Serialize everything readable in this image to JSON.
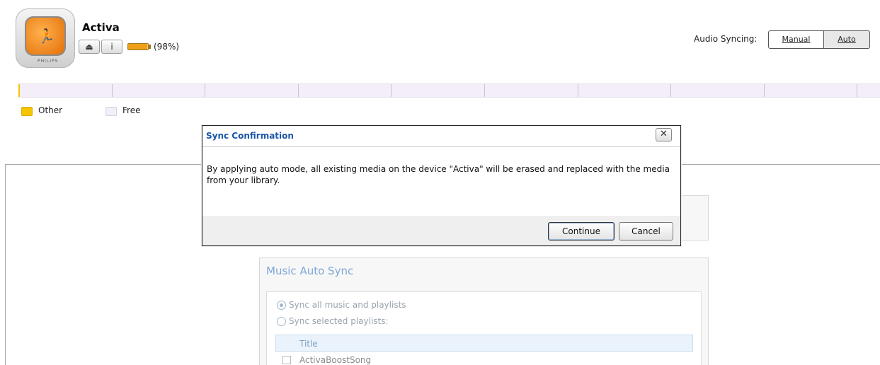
{
  "device": {
    "name": "Activa",
    "brand": "PHILIPS",
    "screen_text": "Move",
    "eject_icon": "eject-icon",
    "info_label": "i",
    "battery_percent": 0.98,
    "battery_text": "(98%)"
  },
  "sync": {
    "label": "Audio Syncing:",
    "manual_label": "Manual",
    "auto_label": "Auto",
    "selected": "Auto"
  },
  "capacity": {
    "other_fraction": 0.002,
    "segments": 10,
    "legend": [
      {
        "label": "Other",
        "color": "#f5c400"
      },
      {
        "label": "Free",
        "color": "#f3eef7"
      }
    ]
  },
  "music": {
    "title": "Music Auto Sync",
    "option_all": "Sync all music and playlists",
    "option_selected": "Sync selected playlists:",
    "column_title": "Title",
    "rows": [
      "ActivaBoostSong"
    ]
  },
  "dialog": {
    "title": "Sync Confirmation",
    "message": "By applying auto mode, all existing media on the device \"Activa\" will be erased and replaced with the media from your library.",
    "close_glyph": "✕",
    "continue_label": "Continue",
    "cancel_label": "Cancel"
  },
  "colors": {
    "accent_blue": "#1a57a8",
    "other_yellow": "#f5c400",
    "device_orange": "#e46f08"
  }
}
